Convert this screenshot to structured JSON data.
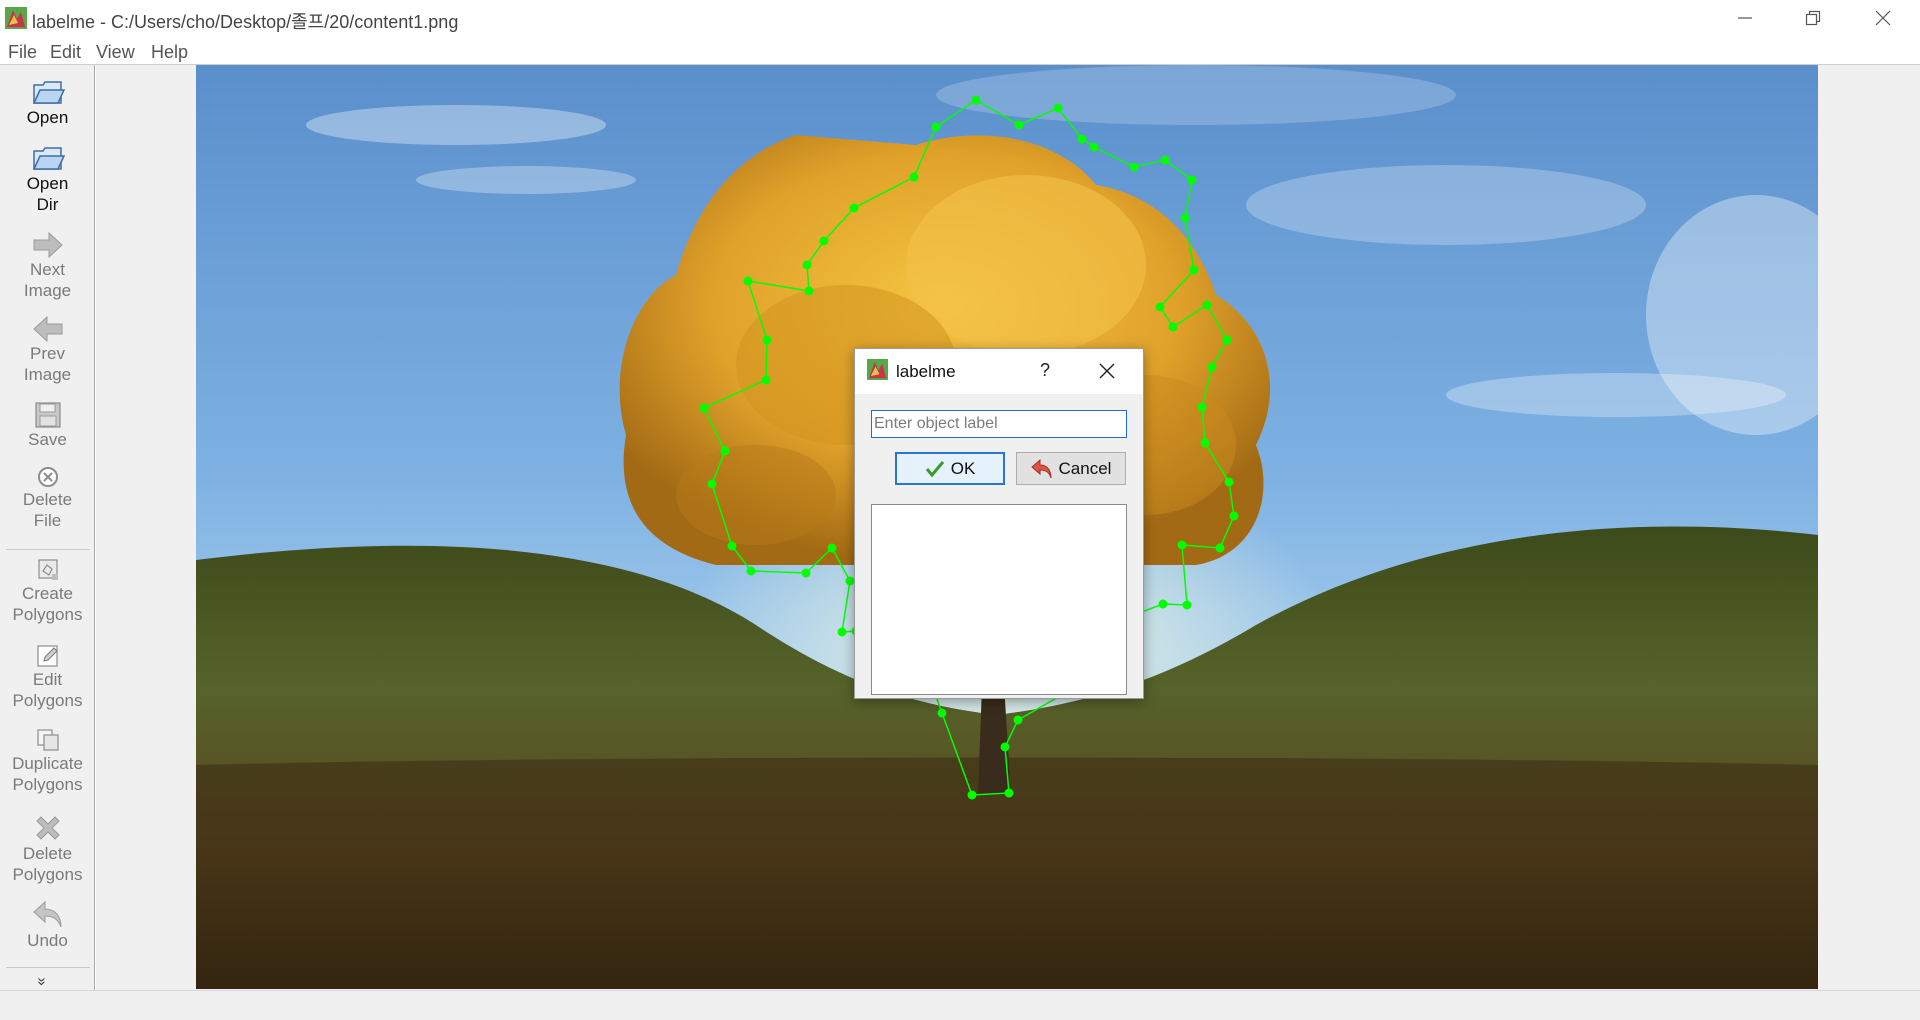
{
  "window": {
    "title": "labelme - C:/Users/cho/Desktop/졸프/20/content1.png",
    "icon": "labelme-logo-icon",
    "controls": [
      "minimize-icon",
      "restore-icon",
      "close-icon"
    ]
  },
  "menu": {
    "file": "File",
    "edit": "Edit",
    "view": "View",
    "help": "Help"
  },
  "toolbar": {
    "open": "Open",
    "open_dir": "Open\nDir",
    "next_image": "Next\nImage",
    "prev_image": "Prev\nImage",
    "save": "Save",
    "delete_file": "Delete\nFile",
    "create_polygons": "Create\nPolygons",
    "edit_polygons": "Edit\nPolygons",
    "duplicate_polygons": "Duplicate\nPolygons",
    "delete_polygons": "Delete\nPolygons",
    "undo": "Undo",
    "more": "»"
  },
  "dialog": {
    "title": "labelme",
    "help": "?",
    "input_placeholder": "Enter object label",
    "input_value": "",
    "ok_label": "OK",
    "cancel_label": "Cancel",
    "label_list": []
  },
  "colors": {
    "polygon": "#00ff00",
    "focus": "#1f6fd1",
    "sky_top": "#6e9ed3",
    "foliage": "#e0a72a",
    "grass": "#4e5a1e"
  }
}
